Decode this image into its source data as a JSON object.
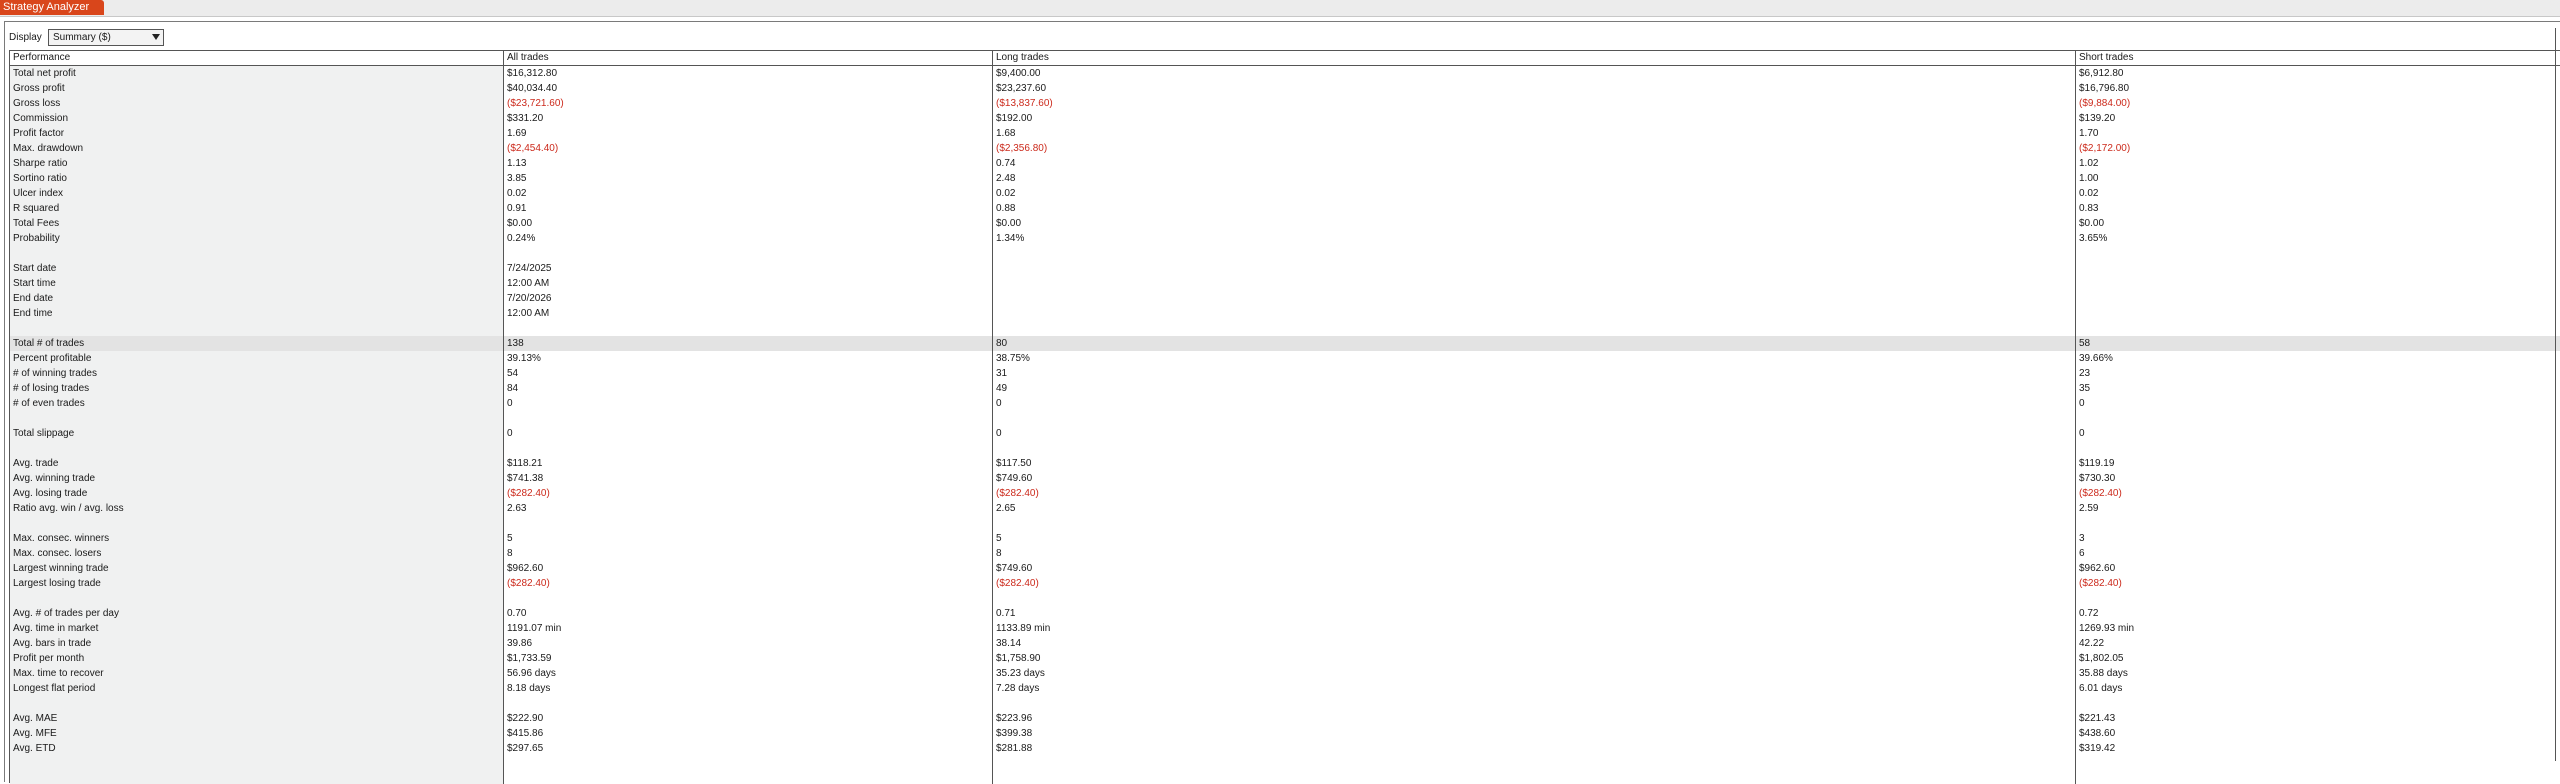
{
  "app": {
    "tab_title": "Strategy Analyzer"
  },
  "display": {
    "label": "Display",
    "selected": "Summary ($)"
  },
  "columns": [
    "Performance",
    "All trades",
    "Long trades",
    "Short trades"
  ],
  "rows": [
    {
      "label": "Total net profit",
      "all": "$16,312.80",
      "long": "$9,400.00",
      "short": "$6,912.80"
    },
    {
      "label": "Gross profit",
      "all": "$40,034.40",
      "long": "$23,237.60",
      "short": "$16,796.80"
    },
    {
      "label": "Gross loss",
      "all": "($23,721.60)",
      "long": "($13,837.60)",
      "short": "($9,884.00)",
      "neg": true
    },
    {
      "label": "Commission",
      "all": "$331.20",
      "long": "$192.00",
      "short": "$139.20"
    },
    {
      "label": "Profit factor",
      "all": "1.69",
      "long": "1.68",
      "short": "1.70"
    },
    {
      "label": "Max. drawdown",
      "all": "($2,454.40)",
      "long": "($2,356.80)",
      "short": "($2,172.00)",
      "neg": true
    },
    {
      "label": "Sharpe ratio",
      "all": "1.13",
      "long": "0.74",
      "short": "1.02"
    },
    {
      "label": "Sortino ratio",
      "all": "3.85",
      "long": "2.48",
      "short": "1.00"
    },
    {
      "label": "Ulcer index",
      "all": "0.02",
      "long": "0.02",
      "short": "0.02"
    },
    {
      "label": "R squared",
      "all": "0.91",
      "long": "0.88",
      "short": "0.83"
    },
    {
      "label": "Total Fees",
      "all": "$0.00",
      "long": "$0.00",
      "short": "$0.00"
    },
    {
      "label": "Probability",
      "all": "0.24%",
      "long": "1.34%",
      "short": "3.65%"
    },
    {
      "label": "",
      "all": "",
      "long": "",
      "short": ""
    },
    {
      "label": "Start date",
      "all": "7/24/2025",
      "long": "",
      "short": ""
    },
    {
      "label": "Start time",
      "all": "12:00 AM",
      "long": "",
      "short": ""
    },
    {
      "label": "End date",
      "all": "7/20/2026",
      "long": "",
      "short": ""
    },
    {
      "label": "End time",
      "all": "12:00 AM",
      "long": "",
      "short": ""
    },
    {
      "label": "",
      "all": "",
      "long": "",
      "short": ""
    },
    {
      "label": "Total # of trades",
      "all": "138",
      "long": "80",
      "short": "58",
      "highlight": true
    },
    {
      "label": "Percent profitable",
      "all": "39.13%",
      "long": "38.75%",
      "short": "39.66%"
    },
    {
      "label": "# of winning trades",
      "all": "54",
      "long": "31",
      "short": "23"
    },
    {
      "label": "# of losing trades",
      "all": "84",
      "long": "49",
      "short": "35"
    },
    {
      "label": "# of even trades",
      "all": "0",
      "long": "0",
      "short": "0"
    },
    {
      "label": "",
      "all": "",
      "long": "",
      "short": ""
    },
    {
      "label": "Total slippage",
      "all": "0",
      "long": "0",
      "short": "0"
    },
    {
      "label": "",
      "all": "",
      "long": "",
      "short": ""
    },
    {
      "label": "Avg. trade",
      "all": "$118.21",
      "long": "$117.50",
      "short": "$119.19"
    },
    {
      "label": "Avg. winning trade",
      "all": "$741.38",
      "long": "$749.60",
      "short": "$730.30"
    },
    {
      "label": "Avg. losing trade",
      "all": "($282.40)",
      "long": "($282.40)",
      "short": "($282.40)",
      "neg": true
    },
    {
      "label": "Ratio avg. win / avg. loss",
      "all": "2.63",
      "long": "2.65",
      "short": "2.59"
    },
    {
      "label": "",
      "all": "",
      "long": "",
      "short": ""
    },
    {
      "label": "Max. consec. winners",
      "all": "5",
      "long": "5",
      "short": "3"
    },
    {
      "label": "Max. consec. losers",
      "all": "8",
      "long": "8",
      "short": "6"
    },
    {
      "label": "Largest winning trade",
      "all": "$962.60",
      "long": "$749.60",
      "short": "$962.60"
    },
    {
      "label": "Largest losing trade",
      "all": "($282.40)",
      "long": "($282.40)",
      "short": "($282.40)",
      "neg": true
    },
    {
      "label": "",
      "all": "",
      "long": "",
      "short": ""
    },
    {
      "label": "Avg. # of trades per day",
      "all": "0.70",
      "long": "0.71",
      "short": "0.72"
    },
    {
      "label": "Avg. time in market",
      "all": "1191.07 min",
      "long": "1133.89 min",
      "short": "1269.93 min"
    },
    {
      "label": "Avg. bars in trade",
      "all": "39.86",
      "long": "38.14",
      "short": "42.22"
    },
    {
      "label": "Profit per month",
      "all": "$1,733.59",
      "long": "$1,758.90",
      "short": "$1,802.05"
    },
    {
      "label": "Max. time to recover",
      "all": "56.96 days",
      "long": "35.23 days",
      "short": "35.88 days"
    },
    {
      "label": "Longest flat period",
      "all": "8.18 days",
      "long": "7.28 days",
      "short": "6.01 days"
    },
    {
      "label": "",
      "all": "",
      "long": "",
      "short": ""
    },
    {
      "label": "Avg. MAE",
      "all": "$222.90",
      "long": "$223.96",
      "short": "$221.43"
    },
    {
      "label": "Avg. MFE",
      "all": "$415.86",
      "long": "$399.38",
      "short": "$438.60"
    },
    {
      "label": "Avg. ETD",
      "all": "$297.65",
      "long": "$281.88",
      "short": "$319.42"
    }
  ]
}
